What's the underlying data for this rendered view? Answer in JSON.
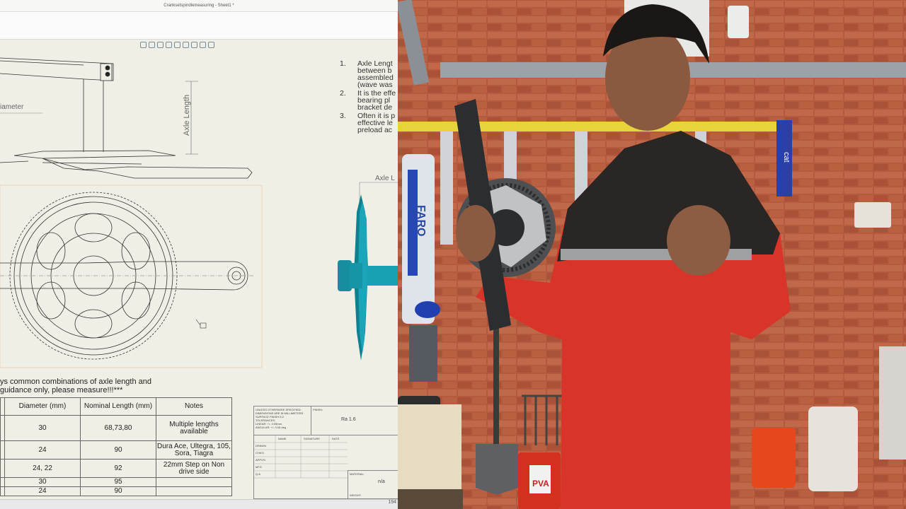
{
  "window": {
    "title": "Cranksetspindlemeasuring - Sheet1 *"
  },
  "drawing": {
    "labels": {
      "axle_length": "Axle Length",
      "diameter": "iameter",
      "axle_l": "Axle L"
    },
    "notes": [
      {
        "num": "1.",
        "lines": [
          "Axle Lengt",
          "between b",
          "assembled",
          "(wave was"
        ]
      },
      {
        "num": "2.",
        "lines": [
          "It is the effe",
          "bearing pl",
          "bracket de"
        ]
      },
      {
        "num": "3.",
        "lines": [
          "Often it is p",
          "effective le",
          "preload ac"
        ]
      }
    ],
    "caption": [
      "ys common combinations of axle length and",
      "guidance only, please measure!!!***"
    ]
  },
  "table": {
    "headers": [
      "",
      "Diameter (mm)",
      "Nominal Length (mm)",
      "Notes"
    ],
    "rows": [
      [
        "",
        "30",
        "68,73,80",
        "Multiple lengths available"
      ],
      [
        "",
        "24",
        "90",
        "Dura Ace, Ultegra, 105, Sora, Tiagra"
      ],
      [
        "",
        "24, 22",
        "92",
        "22mm Step on Non drive side"
      ],
      [
        "",
        "30",
        "95",
        ""
      ],
      [
        "",
        "24",
        "90",
        ""
      ]
    ]
  },
  "titleblock": {
    "spec_text": [
      "UNLESS OTHERWISE SPECIFIED:",
      "DIMENSIONS ARE IN MILLIMETERS",
      "SURFACE FINISH:3.2",
      "TOLERANCES:",
      "LINEAR: +/- 0.05mm",
      "ANGULAR: +/- 0.05 deg"
    ],
    "finish_label": "FINISH:",
    "finish": "Ra 1.6",
    "cols": [
      "NAME",
      "SIGNATURE",
      "DATE"
    ],
    "rows": [
      "DRAWN",
      "CHK'D",
      "APPV'D",
      "MFG",
      "Q.A"
    ],
    "material_label": "MATERIAL:",
    "material": "n/a",
    "weight_label": "WEIGHT:"
  },
  "status": {
    "text": "194"
  },
  "video": {
    "brands": {
      "faro": "FARO",
      "cat": "cat",
      "pva": "PVA"
    }
  },
  "colors": {
    "teal": "#1595a6",
    "overall_red": "#d8342a",
    "brick": "#b45a3e",
    "ladder": "#e6d43a"
  }
}
